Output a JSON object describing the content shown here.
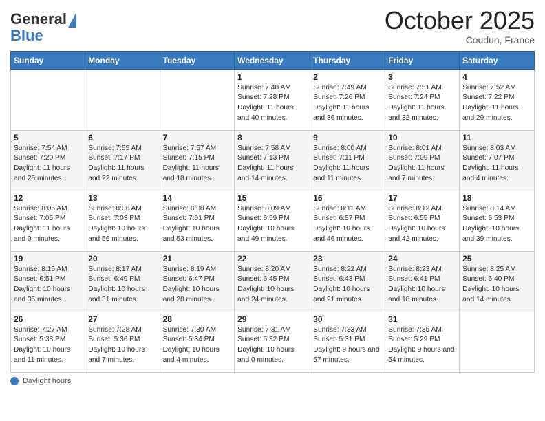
{
  "header": {
    "logo_general": "General",
    "logo_blue": "Blue",
    "month": "October 2025",
    "location": "Coudun, France"
  },
  "days_of_week": [
    "Sunday",
    "Monday",
    "Tuesday",
    "Wednesday",
    "Thursday",
    "Friday",
    "Saturday"
  ],
  "weeks": [
    [
      {
        "day": "",
        "info": ""
      },
      {
        "day": "",
        "info": ""
      },
      {
        "day": "",
        "info": ""
      },
      {
        "day": "1",
        "info": "Sunrise: 7:48 AM\nSunset: 7:28 PM\nDaylight: 11 hours and 40 minutes."
      },
      {
        "day": "2",
        "info": "Sunrise: 7:49 AM\nSunset: 7:26 PM\nDaylight: 11 hours and 36 minutes."
      },
      {
        "day": "3",
        "info": "Sunrise: 7:51 AM\nSunset: 7:24 PM\nDaylight: 11 hours and 32 minutes."
      },
      {
        "day": "4",
        "info": "Sunrise: 7:52 AM\nSunset: 7:22 PM\nDaylight: 11 hours and 29 minutes."
      }
    ],
    [
      {
        "day": "5",
        "info": "Sunrise: 7:54 AM\nSunset: 7:20 PM\nDaylight: 11 hours and 25 minutes."
      },
      {
        "day": "6",
        "info": "Sunrise: 7:55 AM\nSunset: 7:17 PM\nDaylight: 11 hours and 22 minutes."
      },
      {
        "day": "7",
        "info": "Sunrise: 7:57 AM\nSunset: 7:15 PM\nDaylight: 11 hours and 18 minutes."
      },
      {
        "day": "8",
        "info": "Sunrise: 7:58 AM\nSunset: 7:13 PM\nDaylight: 11 hours and 14 minutes."
      },
      {
        "day": "9",
        "info": "Sunrise: 8:00 AM\nSunset: 7:11 PM\nDaylight: 11 hours and 11 minutes."
      },
      {
        "day": "10",
        "info": "Sunrise: 8:01 AM\nSunset: 7:09 PM\nDaylight: 11 hours and 7 minutes."
      },
      {
        "day": "11",
        "info": "Sunrise: 8:03 AM\nSunset: 7:07 PM\nDaylight: 11 hours and 4 minutes."
      }
    ],
    [
      {
        "day": "12",
        "info": "Sunrise: 8:05 AM\nSunset: 7:05 PM\nDaylight: 11 hours and 0 minutes."
      },
      {
        "day": "13",
        "info": "Sunrise: 8:06 AM\nSunset: 7:03 PM\nDaylight: 10 hours and 56 minutes."
      },
      {
        "day": "14",
        "info": "Sunrise: 8:08 AM\nSunset: 7:01 PM\nDaylight: 10 hours and 53 minutes."
      },
      {
        "day": "15",
        "info": "Sunrise: 8:09 AM\nSunset: 6:59 PM\nDaylight: 10 hours and 49 minutes."
      },
      {
        "day": "16",
        "info": "Sunrise: 8:11 AM\nSunset: 6:57 PM\nDaylight: 10 hours and 46 minutes."
      },
      {
        "day": "17",
        "info": "Sunrise: 8:12 AM\nSunset: 6:55 PM\nDaylight: 10 hours and 42 minutes."
      },
      {
        "day": "18",
        "info": "Sunrise: 8:14 AM\nSunset: 6:53 PM\nDaylight: 10 hours and 39 minutes."
      }
    ],
    [
      {
        "day": "19",
        "info": "Sunrise: 8:15 AM\nSunset: 6:51 PM\nDaylight: 10 hours and 35 minutes."
      },
      {
        "day": "20",
        "info": "Sunrise: 8:17 AM\nSunset: 6:49 PM\nDaylight: 10 hours and 31 minutes."
      },
      {
        "day": "21",
        "info": "Sunrise: 8:19 AM\nSunset: 6:47 PM\nDaylight: 10 hours and 28 minutes."
      },
      {
        "day": "22",
        "info": "Sunrise: 8:20 AM\nSunset: 6:45 PM\nDaylight: 10 hours and 24 minutes."
      },
      {
        "day": "23",
        "info": "Sunrise: 8:22 AM\nSunset: 6:43 PM\nDaylight: 10 hours and 21 minutes."
      },
      {
        "day": "24",
        "info": "Sunrise: 8:23 AM\nSunset: 6:41 PM\nDaylight: 10 hours and 18 minutes."
      },
      {
        "day": "25",
        "info": "Sunrise: 8:25 AM\nSunset: 6:40 PM\nDaylight: 10 hours and 14 minutes."
      }
    ],
    [
      {
        "day": "26",
        "info": "Sunrise: 7:27 AM\nSunset: 5:38 PM\nDaylight: 10 hours and 11 minutes."
      },
      {
        "day": "27",
        "info": "Sunrise: 7:28 AM\nSunset: 5:36 PM\nDaylight: 10 hours and 7 minutes."
      },
      {
        "day": "28",
        "info": "Sunrise: 7:30 AM\nSunset: 5:34 PM\nDaylight: 10 hours and 4 minutes."
      },
      {
        "day": "29",
        "info": "Sunrise: 7:31 AM\nSunset: 5:32 PM\nDaylight: 10 hours and 0 minutes."
      },
      {
        "day": "30",
        "info": "Sunrise: 7:33 AM\nSunset: 5:31 PM\nDaylight: 9 hours and 57 minutes."
      },
      {
        "day": "31",
        "info": "Sunrise: 7:35 AM\nSunset: 5:29 PM\nDaylight: 9 hours and 54 minutes."
      },
      {
        "day": "",
        "info": ""
      }
    ]
  ],
  "footer": {
    "label": "Daylight hours"
  }
}
